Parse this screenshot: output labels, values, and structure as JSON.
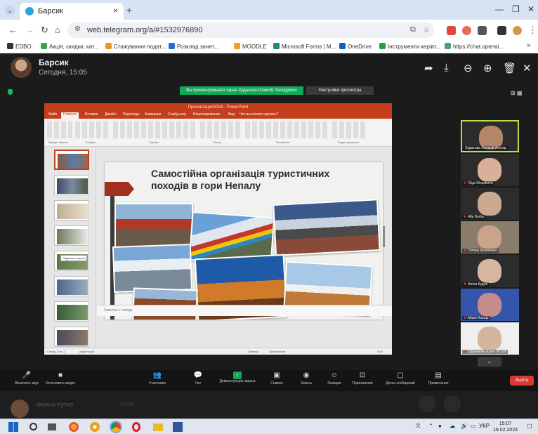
{
  "browser": {
    "tab_title": "Барсик",
    "url": "web.telegram.org/a/#1532976890",
    "bookmarks": [
      {
        "label": "EDBO",
        "color": "#333333"
      },
      {
        "label": "Акція, скидки, кат...",
        "color": "#3fa14a"
      },
      {
        "label": "Стажування подат...",
        "color": "#e59a1a"
      },
      {
        "label": "Розклад занят...",
        "color": "#2b6bd1"
      },
      {
        "label": "MOODLE",
        "color": "#f0a020"
      },
      {
        "label": "Microsoft Forms | M...",
        "color": "#1f8a70"
      },
      {
        "label": "OneDrive",
        "color": "#0b64c0"
      },
      {
        "label": "Інструменти керівт...",
        "color": "#2a9d3c"
      },
      {
        "label": "https://chat.openai...",
        "color": "#4a9f7f"
      }
    ]
  },
  "viewer": {
    "sender_name": "Барсик",
    "sent_time": "Сегодня, 15:05",
    "bottom_name": "Фаина Кутко",
    "bottom_time": "15:03"
  },
  "zoom": {
    "banner": "Вы просматриваете экран Худасова Олексій Леонідович",
    "view_options": "Настройки просмотра",
    "participants": [
      {
        "name": "Худасова Олексій Леонід",
        "skin": "#b48668",
        "bg": "#7a6a58",
        "active": true
      },
      {
        "name": "Olga Shopikova",
        "skin": "#d9b09a",
        "bg": "#4a4a4a",
        "active": false
      },
      {
        "name": "Alla Borbo",
        "skin": "#caa98e",
        "bg": "#5b5244",
        "active": false
      },
      {
        "name": "Тетяна Архипенко",
        "skin": "#c9a48a",
        "bg": "#8a7c6a",
        "active": false
      },
      {
        "name": "Аліна Кудля",
        "skin": "#d7b6a0",
        "bg": "#2e2e2e",
        "active": false
      },
      {
        "name": "Марія Балць",
        "skin": "#c58c8c",
        "bg": "#3355aa",
        "active": false
      },
      {
        "name": "Єфремова Юлія ТК 108",
        "skin": "#d6b59e",
        "bg": "#efefef",
        "active": false
      }
    ],
    "toolbar": [
      {
        "icon": "🎤",
        "label": "Включить звук",
        "name": "unmute-button"
      },
      {
        "icon": "■",
        "label": "Остановить видео",
        "name": "stop-video-button"
      },
      {
        "icon": "👥",
        "label": "Участники",
        "name": "participants-button"
      },
      {
        "icon": "💬",
        "label": "Чат",
        "name": "chat-button"
      },
      {
        "icon": "↑",
        "label": "Демонстрация экрана",
        "name": "share-screen-button"
      },
      {
        "icon": "▣",
        "label": "Снимок",
        "name": "snapshot-button"
      },
      {
        "icon": "◉",
        "label": "Запись",
        "name": "record-button"
      },
      {
        "icon": "☺",
        "label": "Реакции",
        "name": "reactions-button"
      },
      {
        "icon": "⊡",
        "label": "Приложения",
        "name": "apps-button"
      },
      {
        "icon": "▢",
        "label": "Доска сообщений",
        "name": "whiteboard-button"
      },
      {
        "icon": "▤",
        "label": "Примечания",
        "name": "notes-button"
      }
    ],
    "leave": "Выйти"
  },
  "ppt": {
    "title_bar": "Презентация2024 - PowerPoint",
    "tabs": [
      "Файл",
      "Главная",
      "Вставка",
      "Дизайн",
      "Переходы",
      "Анимация",
      "Слайд-шоу",
      "Рецензирование",
      "Вид",
      "Что вы хотите сделать?"
    ],
    "ribbon_groups": [
      "Буфер обмена",
      "Слайды",
      "Шрифт",
      "Абзац",
      "Рисование",
      "Редактирование"
    ],
    "tooltip": "Людська сторона",
    "slide_title": "Самостійна організація туристичних походів в гори Непалу",
    "notes_placeholder": "Заметки к слайду",
    "status_left": "Слайд 1 из 12",
    "status_lang": "украинский",
    "status_right": "Заметки",
    "status_comments": "Примечания",
    "zoom_level": "61%"
  },
  "taskbar": {
    "lang": "УКР",
    "time": "15:07",
    "date": "19.02.2024"
  },
  "colors": {
    "ppt_accent": "#c43e1c",
    "zoom_green": "#0fa95a",
    "leave_red": "#d93a34"
  }
}
